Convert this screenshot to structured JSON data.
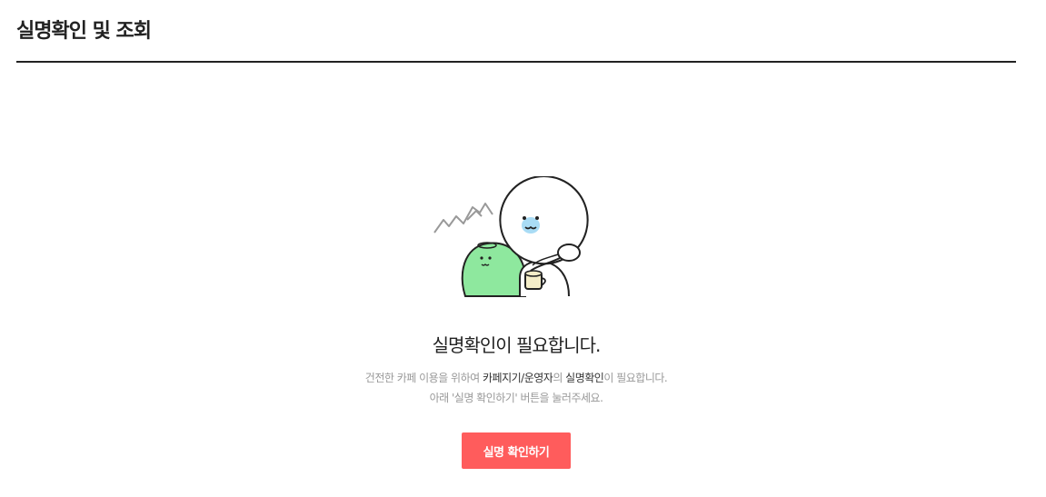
{
  "page": {
    "title": "실명확인 및 조회"
  },
  "empty_state": {
    "illustration_icon": "character-with-teacup-illustration",
    "headline": "실명확인이 필요합니다.",
    "line1_prefix": "건전한 카페 이용을 위하여 ",
    "line1_emphasis_1": "카페지기/운영자",
    "line1_middle": "의 ",
    "line1_emphasis_2": "실명확인",
    "line1_suffix": "이 필요합니다.",
    "line2": "아래 '실명 확인하기' 버튼을 눌러주세요."
  },
  "actions": {
    "verify_button_label": "실명 확인하기"
  },
  "colors": {
    "accent": "#ff5c5c",
    "character_green": "#8ee89e",
    "cheek_blue": "#a9dcf5"
  }
}
